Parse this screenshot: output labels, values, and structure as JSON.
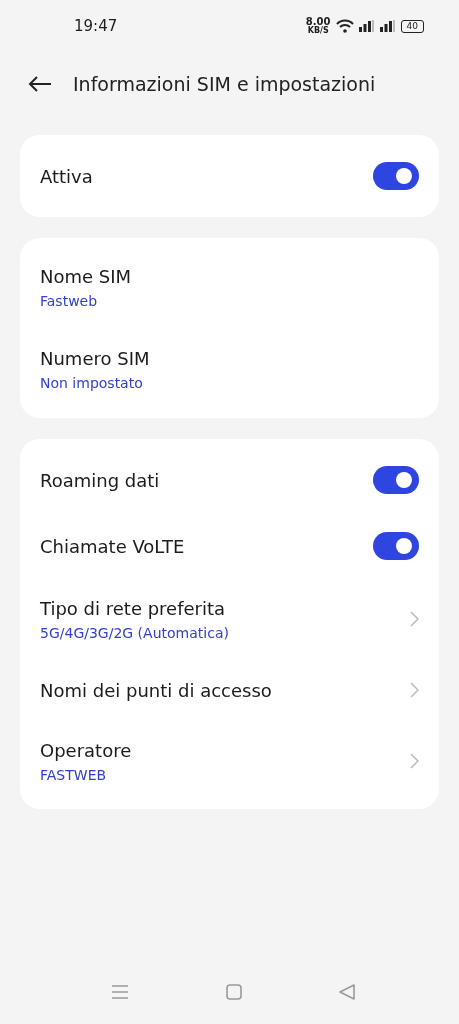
{
  "status_bar": {
    "time": "19:47",
    "speed_value": "8.00",
    "speed_unit": "KB/S",
    "battery": "40"
  },
  "header": {
    "title": "Informazioni SIM e impostazioni"
  },
  "cards": [
    {
      "rows": [
        {
          "kind": "toggle",
          "label": "Attiva",
          "on": true
        }
      ]
    },
    {
      "rows": [
        {
          "kind": "info",
          "label": "Nome SIM",
          "value": "Fastweb"
        },
        {
          "kind": "info",
          "label": "Numero SIM",
          "value": "Non impostato"
        }
      ]
    },
    {
      "rows": [
        {
          "kind": "toggle",
          "label": "Roaming dati",
          "on": true
        },
        {
          "kind": "toggle",
          "label": "Chiamate VoLTE",
          "on": true
        },
        {
          "kind": "link",
          "label": "Tipo di rete preferita",
          "value": "5G/4G/3G/2G (Automatica)"
        },
        {
          "kind": "link",
          "label": "Nomi dei punti di accesso"
        },
        {
          "kind": "link",
          "label": "Operatore",
          "value": "FASTWEB"
        }
      ]
    }
  ]
}
